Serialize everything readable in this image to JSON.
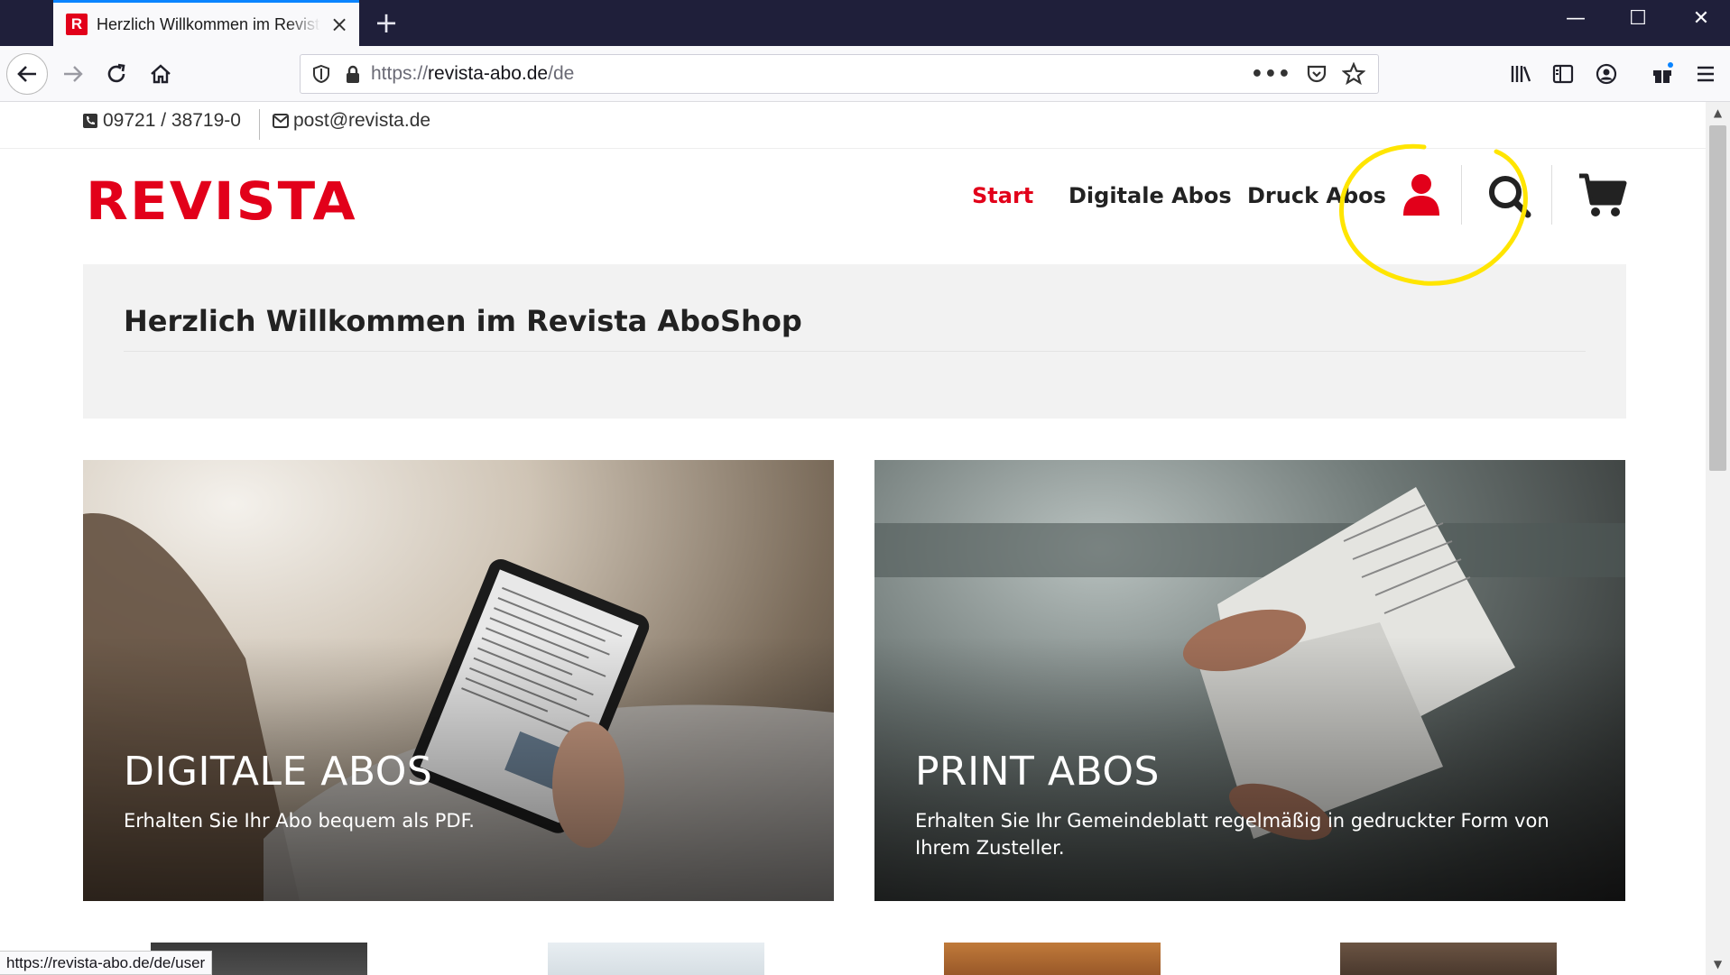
{
  "browser": {
    "tab_title": "Herzlich Willkommen im Revista AboShop",
    "tab_favicon_letter": "R",
    "url_prefix": "https://",
    "url_host": "revista-abo.de",
    "url_path": "/de",
    "status_url": "https://revista-abo.de/de/user",
    "new_tab_glyph": "+",
    "close_glyph": "×"
  },
  "contact": {
    "phone": "09721 / 38719-0",
    "email": "post@revista.de"
  },
  "header": {
    "logo": "REVISTA",
    "nav": [
      {
        "label": "Start"
      },
      {
        "label": "Digitale Abos"
      },
      {
        "label": "Druck Abos"
      }
    ]
  },
  "welcome": {
    "title": "Herzlich Willkommen im Revista AboShop"
  },
  "cards": [
    {
      "title": "DIGITALE ABOS",
      "text": "Erhalten Sie Ihr Abo bequem als PDF."
    },
    {
      "title": "PRINT ABOS",
      "text": "Erhalten Sie Ihr Gemeindeblatt regelmäßig in gedruckter Form von Ihrem Zusteller."
    }
  ],
  "colors": {
    "brand_red": "#e2001a",
    "annotation_yellow": "#ffe500",
    "tab_bar": "#1f1f3a"
  },
  "icons": [
    "back-arrow-icon",
    "forward-arrow-icon",
    "reload-icon",
    "home-icon",
    "shield-icon",
    "lock-icon",
    "more-icon",
    "pocket-icon",
    "star-icon",
    "library-icon",
    "sidebar-icon",
    "account-icon",
    "extensions-icon",
    "menu-icon",
    "phone-icon",
    "mail-icon",
    "user-icon",
    "search-icon",
    "cart-icon"
  ]
}
